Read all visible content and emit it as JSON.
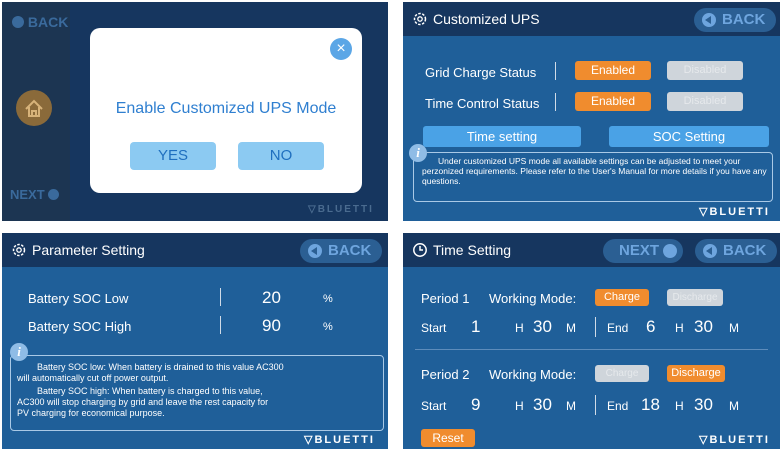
{
  "panel1": {
    "back_label": "BACK",
    "next_label": "NEXT",
    "dialog_text": "Enable Customized UPS Mode",
    "yes_label": "YES",
    "no_label": "NO",
    "brand": "BLUETTI"
  },
  "panel2": {
    "title": "Customized UPS",
    "back_label": "BACK",
    "rows": [
      {
        "label": "Grid Charge Status",
        "enabled": "Enabled",
        "disabled": "Disabled"
      },
      {
        "label": "Time Control Status",
        "enabled": "Enabled",
        "disabled": "Disabled"
      }
    ],
    "time_setting_label": "Time setting",
    "soc_setting_label": "SOC Setting",
    "info_text": "Under customized UPS mode all available settings can be adjusted to meet your perzonized requirements. Please refer to the User's Manual for more details if you have any questions.",
    "brand": "BLUETTI"
  },
  "panel3": {
    "title": "Parameter Setting",
    "back_label": "BACK",
    "rows": [
      {
        "label": "Battery SOC Low",
        "value": "20",
        "unit": "%"
      },
      {
        "label": "Battery SOC High",
        "value": "90",
        "unit": "%"
      }
    ],
    "info_line1": "Battery SOC low:  When battery is drained to this value AC300",
    "info_line2": "will automatically cut off power output.",
    "info_line3": "Battery SOC high:  When battery is charged to this value,",
    "info_line4": "AC300 will stop charging by grid and leave the rest capacity for",
    "info_line5": "PV charging for economical purpose.",
    "brand": "BLUETTI"
  },
  "panel4": {
    "title": "Time Setting",
    "next_label": "NEXT",
    "back_label": "BACK",
    "working_mode_label": "Working Mode:",
    "charge_label": "Charge",
    "discharge_label": "Discharge",
    "start_label": "Start",
    "end_label": "End",
    "h_unit": "H",
    "m_unit": "M",
    "periods": [
      {
        "name": "Period 1",
        "start_h": "1",
        "start_m": "30",
        "end_h": "6",
        "end_m": "30"
      },
      {
        "name": "Period 2",
        "start_h": "9",
        "start_m": "30",
        "end_h": "18",
        "end_m": "30"
      }
    ],
    "reset_label": "Reset",
    "brand": "BLUETTI"
  },
  "colors": {
    "accent": "#f08c2e",
    "panel_bg": "#1f5f99",
    "header_bg": "#16365f",
    "light_button": "#4aa2e6"
  }
}
